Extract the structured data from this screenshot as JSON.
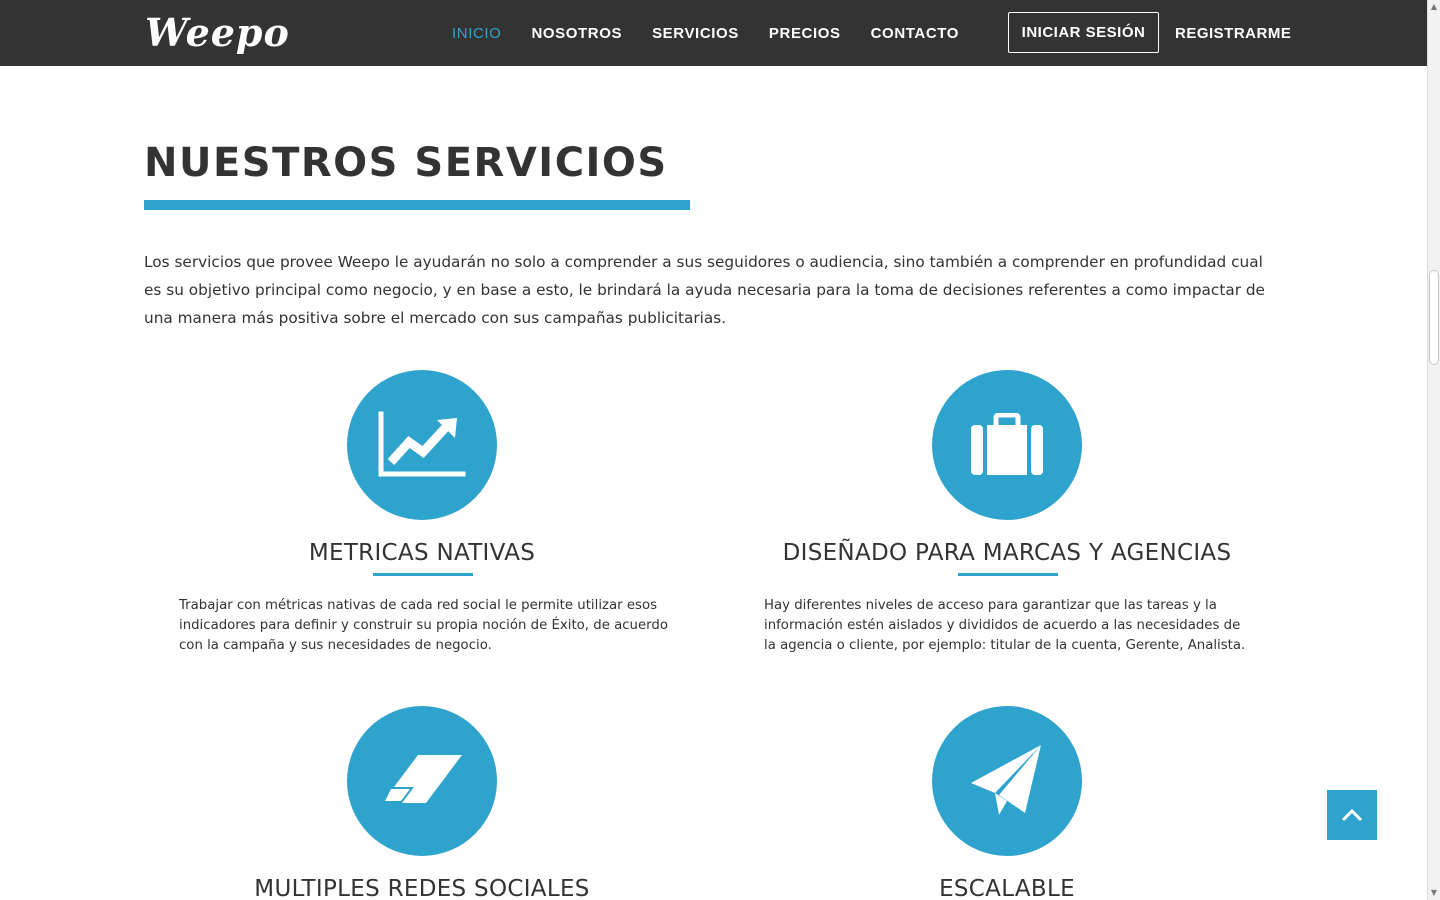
{
  "nav": {
    "logo": "Weepo",
    "links": [
      {
        "label": "INICIO",
        "active": true
      },
      {
        "label": "NOSOTROS",
        "active": false
      },
      {
        "label": "SERVICIOS",
        "active": false
      },
      {
        "label": "PRECIOS",
        "active": false
      },
      {
        "label": "CONTACTO",
        "active": false
      }
    ],
    "login_label": "INICIAR SESIÓN",
    "register_label": "REGISTRARME"
  },
  "section": {
    "title": "NUESTROS SERVICIOS",
    "intro": "Los servicios que provee Weepo le ayudarán no solo a comprender a sus seguidores o audiencia, sino también a comprender en profundidad cual es su objetivo principal como negocio, y en base a esto, le brindará la ayuda necesaria para la toma de decisiones referentes a como impactar de una manera más positiva sobre el mercado con sus campañas publicitarias."
  },
  "services": [
    {
      "icon": "chart-line-icon",
      "title": "METRICAS NATIVAS",
      "description": "Trabajar con métricas nativas de cada red social le permite utilizar esos indicadores para definir y construir su propia noción de Éxito, de acuerdo con la campaña y sus necesidades de negocio."
    },
    {
      "icon": "briefcase-icon",
      "title": "DISEÑADO PARA MARCAS Y AGENCIAS",
      "description": "Hay diferentes niveles de acceso para garantizar que las tareas y la información estén aislados y divididos de acuerdo a las necesidades de la agencia o cliente, por ejemplo: titular de la cuenta, Gerente, Analista."
    },
    {
      "icon": "eraser-icon",
      "title": "MULTIPLES REDES SOCIALES",
      "description": ""
    },
    {
      "icon": "paper-plane-icon",
      "title": "ESCALABLE",
      "description": ""
    }
  ],
  "colors": {
    "accent": "#2ea3cd",
    "navbar": "#333333",
    "text": "#333333"
  }
}
